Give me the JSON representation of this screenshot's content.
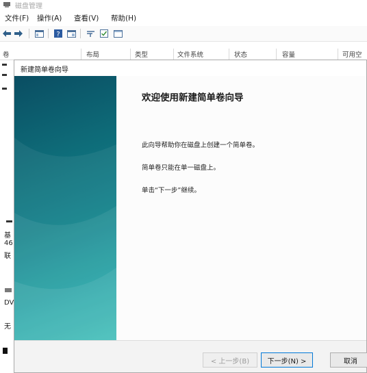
{
  "app": {
    "title": "磁盘管理"
  },
  "menubar": {
    "items": [
      "文件(F)",
      "操作(A)",
      "查看(V)",
      "帮助(H)"
    ]
  },
  "columns": [
    "卷",
    "布局",
    "类型",
    "文件系统",
    "状态",
    "容量",
    "可用空"
  ],
  "background": {
    "disk_label": "基",
    "disk_size": "46",
    "disk_status": "联",
    "dvd_label": "DV",
    "no_media": "无"
  },
  "wizard": {
    "title": "新建简单卷向导",
    "heading": "欢迎使用新建简单卷向导",
    "paragraphs": [
      "此向导帮助你在磁盘上创建一个简单卷。",
      "简单卷只能在单一磁盘上。",
      "单击“下一步”继续。"
    ],
    "buttons": {
      "back": "< 上一步(B)",
      "next": "下一步(N) >",
      "cancel": "取消"
    }
  },
  "colors": {
    "accent": "#0078d7",
    "wizard_side_top": "#0a4d62",
    "wizard_side_bottom": "#2cb7b2"
  }
}
